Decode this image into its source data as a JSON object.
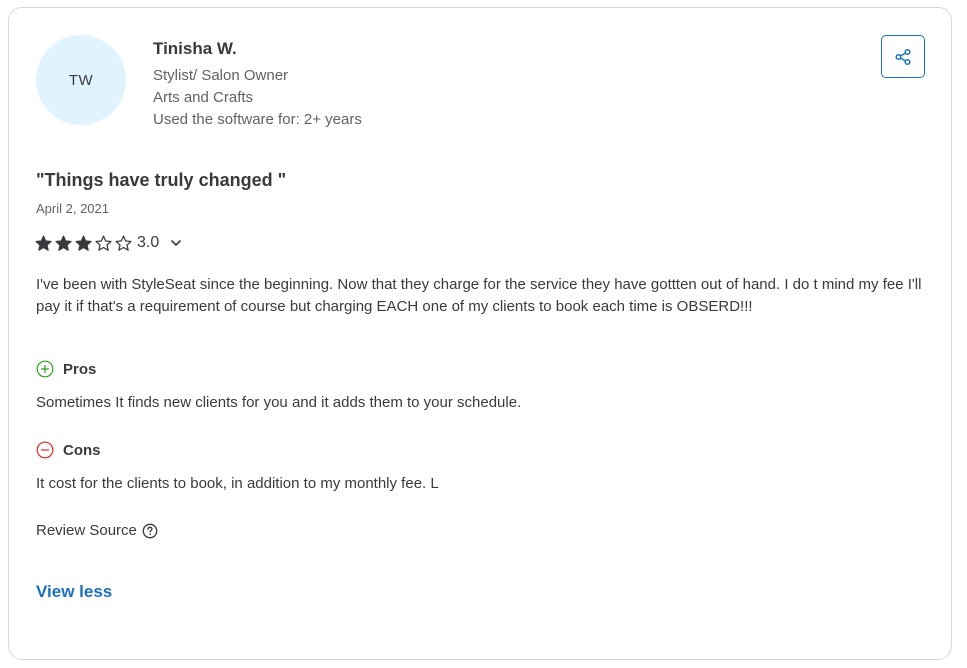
{
  "reviewer": {
    "initials": "TW",
    "name": "Tinisha W.",
    "role": "Stylist/ Salon Owner",
    "industry": "Arts and Crafts",
    "usage": "Used the software for: 2+ years"
  },
  "review": {
    "title": "\"Things have truly changed \"",
    "date": "April 2, 2021",
    "rating": 3,
    "rating_max": 5,
    "rating_label": "3.0",
    "body": "I've been with StyleSeat since the beginning. Now that they charge for the service they have gottten out of hand. I do t mind my fee I'll pay it if that's a requirement of course but charging EACH one of my clients to book each time is OBSERD!!!",
    "pros_label": "Pros",
    "pros_text": "Sometimes It finds new clients for you and it adds them to your schedule.",
    "cons_label": "Cons",
    "cons_text": "It cost for the clients to book, in addition to my monthly fee. L",
    "source_label": "Review Source",
    "view_less_label": "View less"
  },
  "icons": {
    "share": "share-icon",
    "star": "star-icon",
    "chevron": "chevron-down-icon",
    "plus": "plus-circle-icon",
    "minus": "minus-circle-icon",
    "help": "help-circle-icon"
  },
  "colors": {
    "accent": "#1a6fbf",
    "pros": "#2ca01c",
    "cons": "#d52b1e",
    "avatar_bg": "#dff4fe"
  }
}
